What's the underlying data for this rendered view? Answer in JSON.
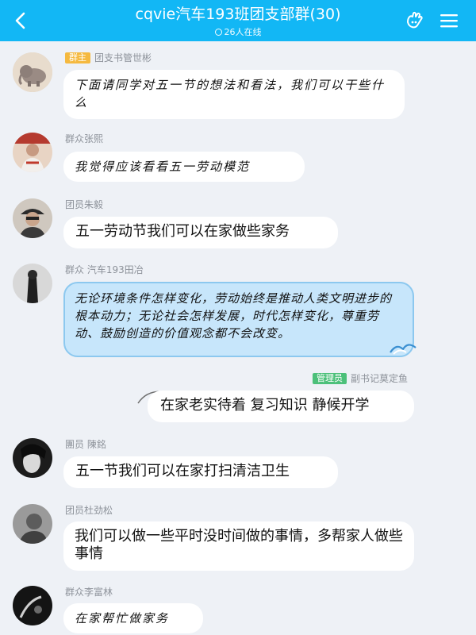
{
  "header": {
    "title": "cqvie汽车193班团支部群(30)",
    "online": "26人在线",
    "bg_color": "#12b7f5"
  },
  "messages": [
    {
      "badge": "群主",
      "sender": "团支书管世彬",
      "text": "下面请同学对五一节的想法和看法，我们可以干些什么",
      "avatar": "avatar-elephant"
    },
    {
      "sender": "群众张熙",
      "text": "我觉得应该看看五一劳动模范",
      "avatar": "avatar-person-red"
    },
    {
      "sender": "团员朱毅",
      "text": "五一劳动节我们可以在家做些家务",
      "avatar": "avatar-person-cap"
    },
    {
      "sender": "群众 汽车193田冶",
      "text": "无论环境条件怎样变化，劳动始终是推动人类文明进步的根本动力；无论社会怎样发展，时代怎样变化，尊重劳动、鼓励创造的价值观念都不会改变。",
      "avatar": "avatar-dark-figure"
    },
    {
      "badge": "管理员",
      "sender": "副书记莫定鱼",
      "text": "在家老实待着 复习知识 静候开学"
    },
    {
      "sender": "團员 陳銘",
      "text": "五一节我们可以在家打扫清洁卫生",
      "avatar": "avatar-dark-portrait"
    },
    {
      "sender": "团员杜劲松",
      "text": "我们可以做一些平时没时间做的事情，多帮家人做些事情",
      "avatar": "avatar-gray-portrait"
    },
    {
      "sender": "群众李富林",
      "text": "在家帮忙做家务",
      "avatar": "avatar-night"
    }
  ]
}
